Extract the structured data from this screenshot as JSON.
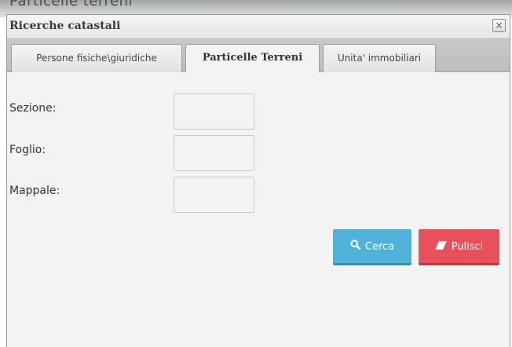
{
  "window": {
    "title": "Ricerche catastali",
    "close_glyph": "×"
  },
  "background_heading": "Particelle terreni",
  "tabs": [
    {
      "label": "Persone fisiche\\giuridiche",
      "active": false
    },
    {
      "label": "Particelle Terreni",
      "active": true
    },
    {
      "label": "Unita' immobiliari",
      "active": false
    }
  ],
  "form": {
    "sezione": {
      "label": "Sezione:",
      "value": ""
    },
    "foglio": {
      "label": "Foglio:",
      "value": ""
    },
    "mappale": {
      "label": "Mappale:",
      "value": ""
    }
  },
  "actions": {
    "search": {
      "label": "Cerca",
      "icon": "search-icon",
      "color": "#4fb3d9"
    },
    "clear": {
      "label": "Pulisci",
      "icon": "eraser-icon",
      "color": "#e8505b"
    }
  }
}
